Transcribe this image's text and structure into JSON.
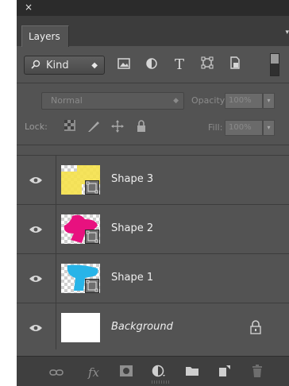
{
  "panel": {
    "close_glyph": "×",
    "tab_label": "Layers",
    "menu_glyph": "▾"
  },
  "filter": {
    "kind_label": "Kind",
    "icons": [
      "image-filter-icon",
      "adjustment-filter-icon",
      "type-filter-icon",
      "shape-filter-icon",
      "smart-object-filter-icon"
    ],
    "type_glyph": "T"
  },
  "blend": {
    "mode": "Normal",
    "opacity_label": "Opacity:",
    "opacity_value": "100%"
  },
  "lock": {
    "label": "Lock:",
    "fill_label": "Fill:",
    "fill_value": "100%"
  },
  "layers": [
    {
      "name": "Shape 3",
      "color": "#f5e14a",
      "kind": "shape"
    },
    {
      "name": "Shape 2",
      "color": "#e8117f",
      "kind": "shape"
    },
    {
      "name": "Shape 1",
      "color": "#27b4e8",
      "kind": "shape"
    },
    {
      "name": "Background",
      "color": "#ffffff",
      "kind": "background",
      "locked": true
    }
  ],
  "footer_icons": [
    "link-layers-icon",
    "fx-icon",
    "layer-mask-icon",
    "adjustment-layer-icon",
    "group-folder-icon",
    "new-layer-icon",
    "trash-icon"
  ],
  "footer": {
    "fx_label": "fx"
  }
}
